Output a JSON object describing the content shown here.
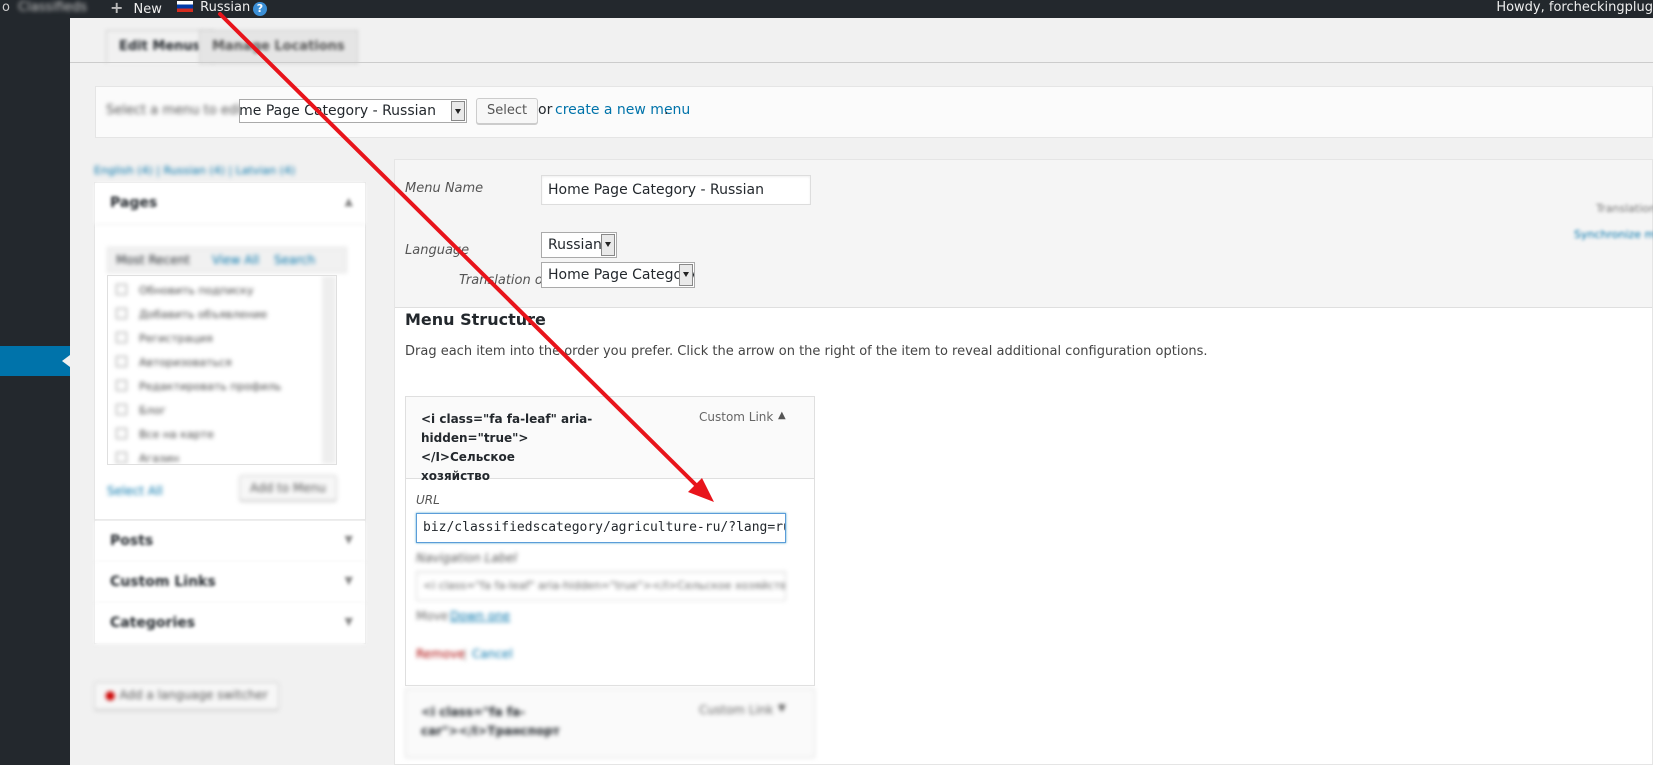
{
  "adminbar": {
    "site_label": "Classifieds",
    "new_label": "New",
    "language_label": "Russian",
    "help_icon": "question-icon",
    "howdy_text": "Howdy, forcheckingplug"
  },
  "tabs": {
    "edit_menus": "Edit Menus",
    "manage_locations": "Manage Locations"
  },
  "manage_bar": {
    "prompt": "Select a menu to edit:",
    "selected_menu": "Home Page Category - Russian",
    "select_button": "Select",
    "or_text": "or",
    "create_link": "create a new menu",
    "period": "."
  },
  "sidebar": {
    "language_filters": "English (4) | Russian (4) | Latvian (4)",
    "pages": {
      "title": "Pages",
      "tabs": [
        "Most Recent",
        "View All",
        "Search"
      ],
      "items": [
        "Обновить подписку",
        "Добавить объявление",
        "Регистрация",
        "Авторизоваться",
        "Редактировать профиль",
        "Блог",
        "Все на карте",
        "Агазин"
      ],
      "select_all": "Select All",
      "add_to_menu": "Add to Menu"
    },
    "posts_title": "Posts",
    "custom_links_title": "Custom Links",
    "categories_title": "Categories",
    "language_switcher_button": "Add a language switcher"
  },
  "menu_header": {
    "menu_name_label": "Menu Name",
    "menu_name_value": "Home Page Category - Russian",
    "language_label": "Language",
    "language_value": "Russian",
    "translation_label": "Translation of",
    "translation_value": "Home Page Category",
    "side_text_1": "Translation",
    "side_text_2": "Synchronize menu"
  },
  "menu_structure": {
    "title": "Menu Structure",
    "instructions": "Drag each item into the order you prefer. Click the arrow on the right of the item to reveal additional configuration options.",
    "item1": {
      "title_line1": "<i class=\"fa fa-leaf\" aria-",
      "title_line2": "hidden=\"true\"></I>Сельское",
      "title_line3": "хозяйство",
      "type": "Custom Link",
      "url_label": "URL",
      "url_value": "biz/classifiedscategory/agriculture-ru/?lang=ru",
      "nav_label": "Navigation Label",
      "nav_value": "<i class=\"fa fa-leaf\" aria-hidden=\"true\"></I>Сельское хозяйство",
      "move_label": "Move",
      "move_link": "Down one",
      "remove_link": "Remove",
      "separator": "|",
      "cancel_link": "Cancel"
    },
    "item2": {
      "title_line1": "<i class=\"fa fa-",
      "title_line2": "car\"></I>Транспорт",
      "type": "Custom Link"
    }
  },
  "colors": {
    "admin_dark": "#23282d",
    "accent": "#0073aa",
    "annotation": "#e8141b"
  }
}
